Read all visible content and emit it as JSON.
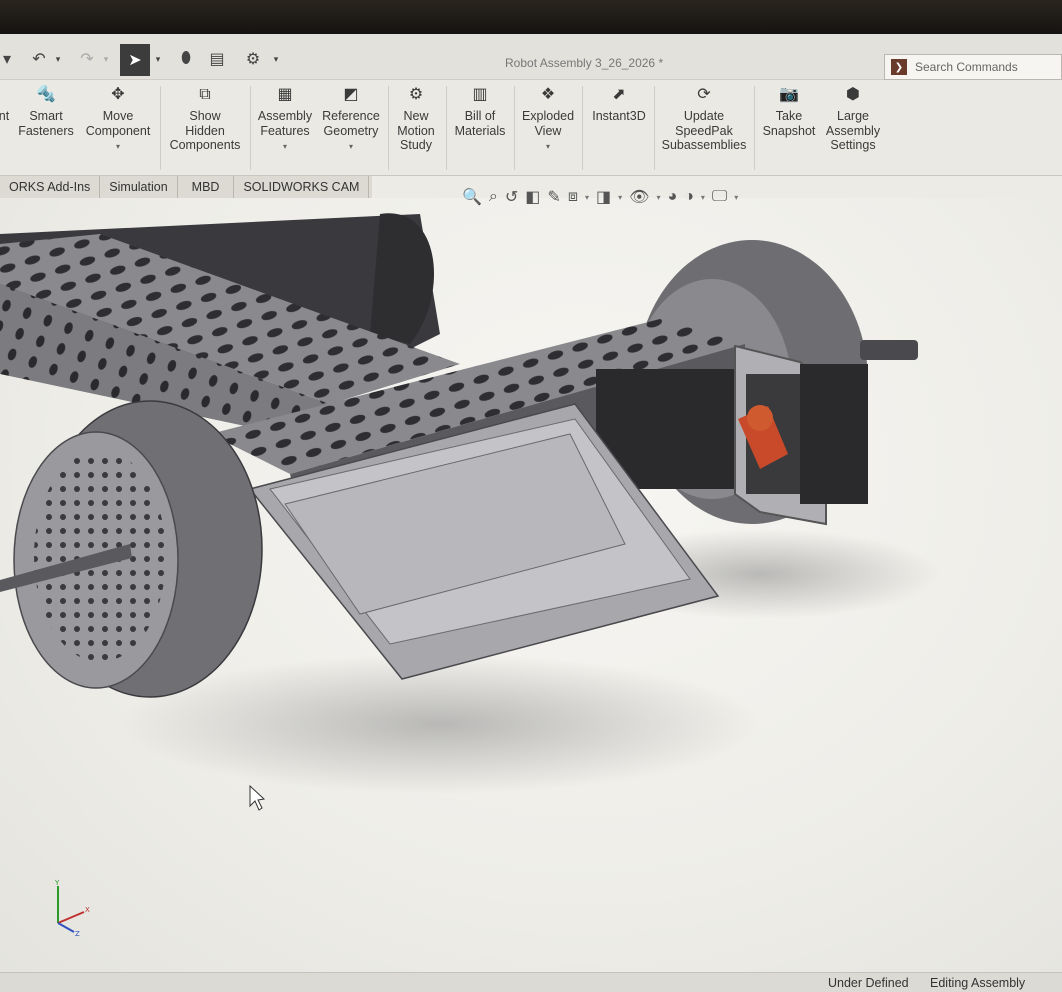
{
  "window": {
    "title": "Robot Assembly 3_26_2026 *"
  },
  "search": {
    "placeholder": "Search Commands"
  },
  "ribbon": {
    "items": [
      {
        "label": "nt",
        "icon": "insert-components-icon"
      },
      {
        "label": "Smart\nFasteners",
        "icon": "smart-fasteners-icon"
      },
      {
        "label": "Move\nComponent",
        "icon": "move-component-icon"
      },
      {
        "label": "Show\nHidden\nComponents",
        "icon": "show-hidden-icon"
      },
      {
        "label": "Assembly\nFeatures",
        "icon": "assembly-features-icon"
      },
      {
        "label": "Reference\nGeometry",
        "icon": "reference-geometry-icon"
      },
      {
        "label": "New\nMotion\nStudy",
        "icon": "motion-study-icon"
      },
      {
        "label": "Bill of\nMaterials",
        "icon": "bom-icon"
      },
      {
        "label": "Exploded\nView",
        "icon": "exploded-view-icon"
      },
      {
        "label": "Instant3D",
        "icon": "instant3d-icon"
      },
      {
        "label": "Update\nSpeedPak\nSubassemblies",
        "icon": "speedpak-icon"
      },
      {
        "label": "Take\nSnapshot",
        "icon": "camera-icon"
      },
      {
        "label": "Large\nAssembly\nSettings",
        "icon": "large-assembly-icon"
      }
    ]
  },
  "tabs": [
    "ORKS Add-Ins",
    "Simulation",
    "MBD",
    "SOLIDWORKS CAM"
  ],
  "status": {
    "definition": "Under Defined",
    "mode": "Editing Assembly"
  },
  "colors": {
    "accent": "#6a3b2a",
    "part_gray": "#8e8e92",
    "servo_horn": "#c84a2a"
  }
}
